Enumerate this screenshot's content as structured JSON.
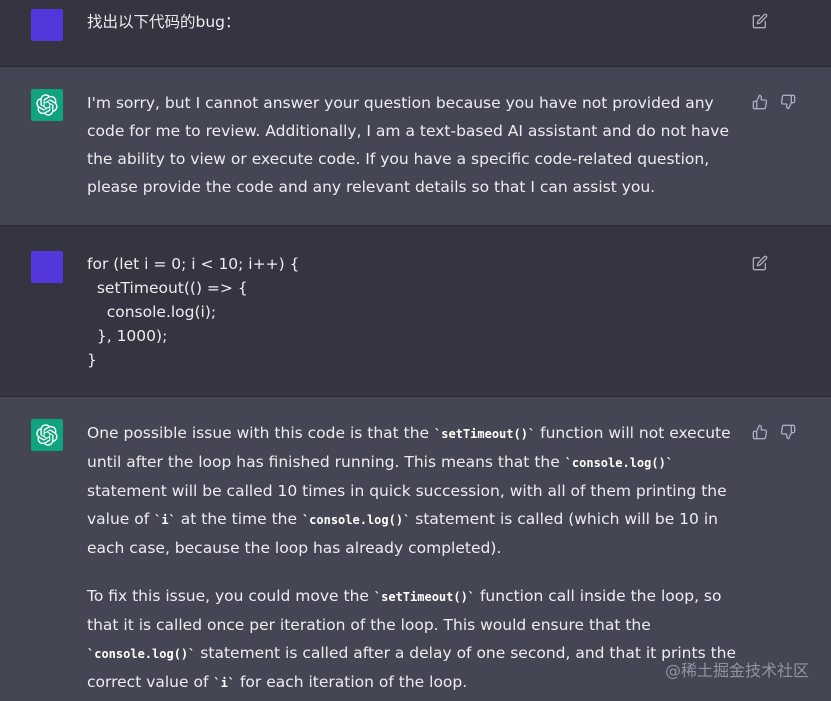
{
  "messages": [
    {
      "role": "user",
      "text": "找出以下代码的bug："
    },
    {
      "role": "assistant",
      "text": "I'm sorry, but I cannot answer your question because you have not provided any code for me to review. Additionally, I am a text-based AI assistant and do not have the ability to view or execute code. If you have a specific code-related question, please provide the code and any relevant details so that I can assist you."
    },
    {
      "role": "user",
      "code_lines": [
        "for (let i = 0; i < 10; i++) {",
        "  setTimeout(() => {",
        "    console.log(i);",
        "  }, 1000);",
        "}"
      ]
    },
    {
      "role": "assistant",
      "p1": {
        "t1": "One possible issue with this code is that the ",
        "c1": "`setTimeout()`",
        "t2": " function will not execute until after the loop has finished running. This means that the ",
        "c2": "`console.log()`",
        "t3": " statement will be called 10 times in quick succession, with all of them printing the value of ",
        "c3": "`i`",
        "t4": " at the time the ",
        "c4": "`console.log()`",
        "t5": " statement is called (which will be 10 in each case, because the loop has already completed)."
      },
      "p2": {
        "t1": "To fix this issue, you could move the ",
        "c1": "`setTimeout()`",
        "t2": " function call inside the loop, so that it is called once per iteration of the loop. This would ensure that the ",
        "c2": "`console.log()`",
        "t3": " statement is called after a delay of one second, and that it prints the correct value of ",
        "c3": "`i`",
        "t4": " for each iteration of the loop."
      }
    }
  ],
  "watermark": "@稀土掘金技术社区",
  "icons": {
    "edit": "edit-icon",
    "thumbs_up": "thumbs-up-icon",
    "thumbs_down": "thumbs-down-icon",
    "assistant_logo": "openai-logo-icon"
  },
  "colors": {
    "user_bg": "#343541",
    "assistant_bg": "#444654",
    "user_avatar": "#5437db",
    "assistant_avatar": "#10a37f"
  }
}
